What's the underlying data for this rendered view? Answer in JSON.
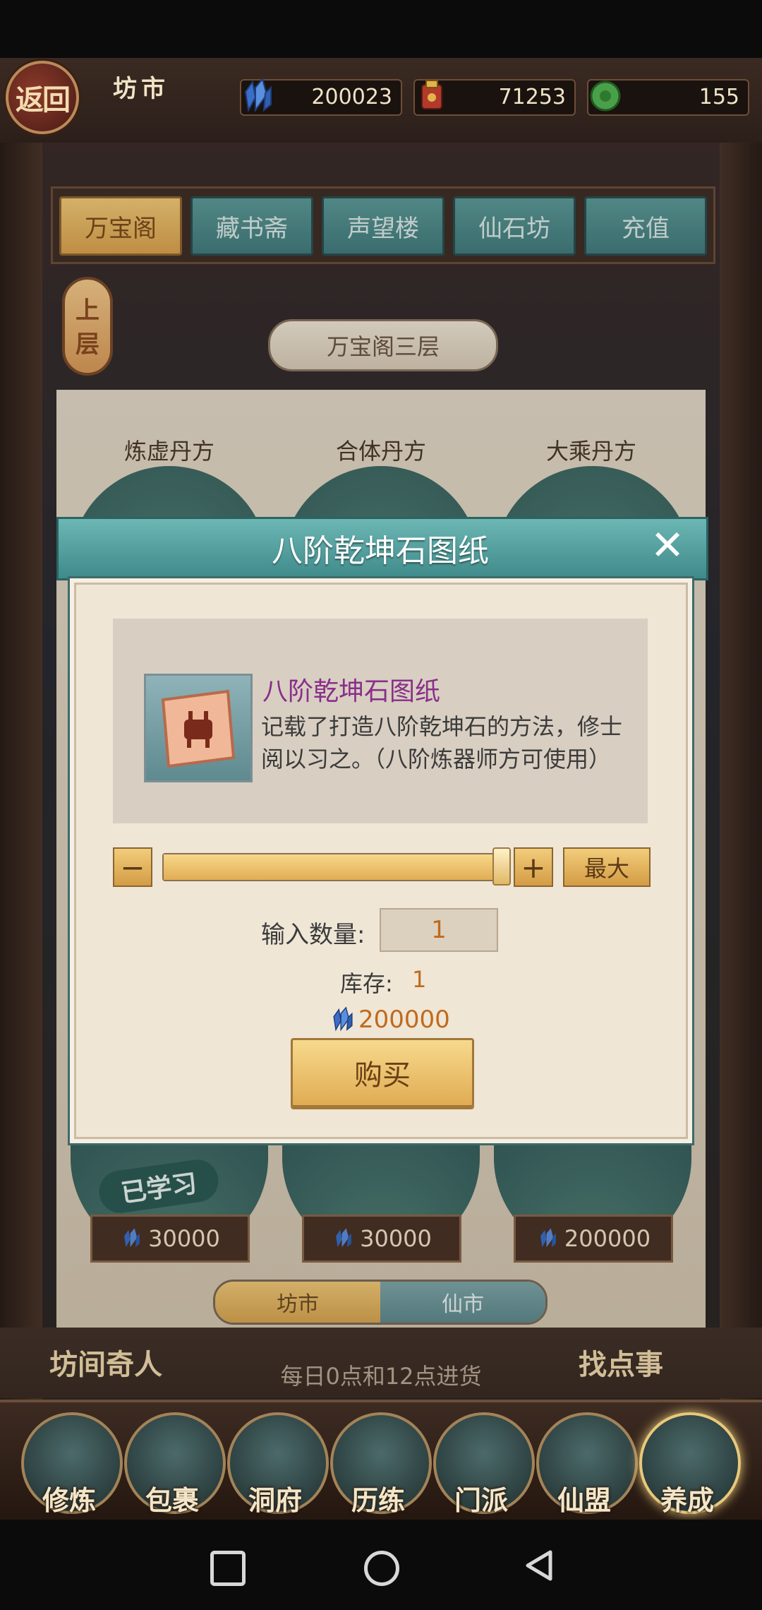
{
  "header": {
    "back_label": "返回",
    "title": "坊市",
    "currencies": [
      {
        "icon": "spirit-crystal-icon",
        "value": "200023"
      },
      {
        "icon": "treasure-pouch-icon",
        "value": "71253"
      },
      {
        "icon": "jade-coin-icon",
        "value": "155"
      }
    ]
  },
  "tabs": [
    {
      "label": "万宝阁",
      "active": true
    },
    {
      "label": "藏书斋",
      "active": false
    },
    {
      "label": "声望楼",
      "active": false
    },
    {
      "label": "仙石坊",
      "active": false
    },
    {
      "label": "充值",
      "active": false
    }
  ],
  "floor": {
    "up_label": "上层",
    "current": "万宝阁三层"
  },
  "shelf": {
    "items": [
      {
        "label": "炼虚丹方",
        "price": "30000",
        "tag": "已学习"
      },
      {
        "label": "合体丹方",
        "price": "30000"
      },
      {
        "label": "大乘丹方",
        "price": "200000"
      }
    ]
  },
  "market_switch": {
    "left": "坊市",
    "right": "仙市"
  },
  "restock_note": "每日0点和12点进货",
  "npc_left": "坊间奇人",
  "npc_right": "找点事",
  "bottom_nav": [
    {
      "label": "修炼",
      "icon": "cultivator-icon"
    },
    {
      "label": "包裹",
      "icon": "bag-icon"
    },
    {
      "label": "洞府",
      "icon": "cave-mansion-icon"
    },
    {
      "label": "历练",
      "icon": "scroll-icon"
    },
    {
      "label": "门派",
      "icon": "sect-gate-icon"
    },
    {
      "label": "仙盟",
      "icon": "alliance-icon"
    },
    {
      "label": "养成",
      "icon": "pentagram-icon"
    }
  ],
  "modal": {
    "title": "八阶乾坤石图纸",
    "item_name": "八阶乾坤石图纸",
    "item_desc": "记载了打造八阶乾坤石的方法，修士阅以习之。（八阶炼器师方可使用）",
    "minus": "−",
    "plus": "+",
    "max_label": "最大",
    "slider_fraction": 1,
    "qty_label": "输入数量:",
    "qty_value": "1",
    "stock_label": "库存:",
    "stock_value": "1",
    "cost_value": "200000",
    "buy_label": "购买",
    "accent_name_color": "#8a2f8a",
    "accent_value_color": "#c06a1c"
  }
}
